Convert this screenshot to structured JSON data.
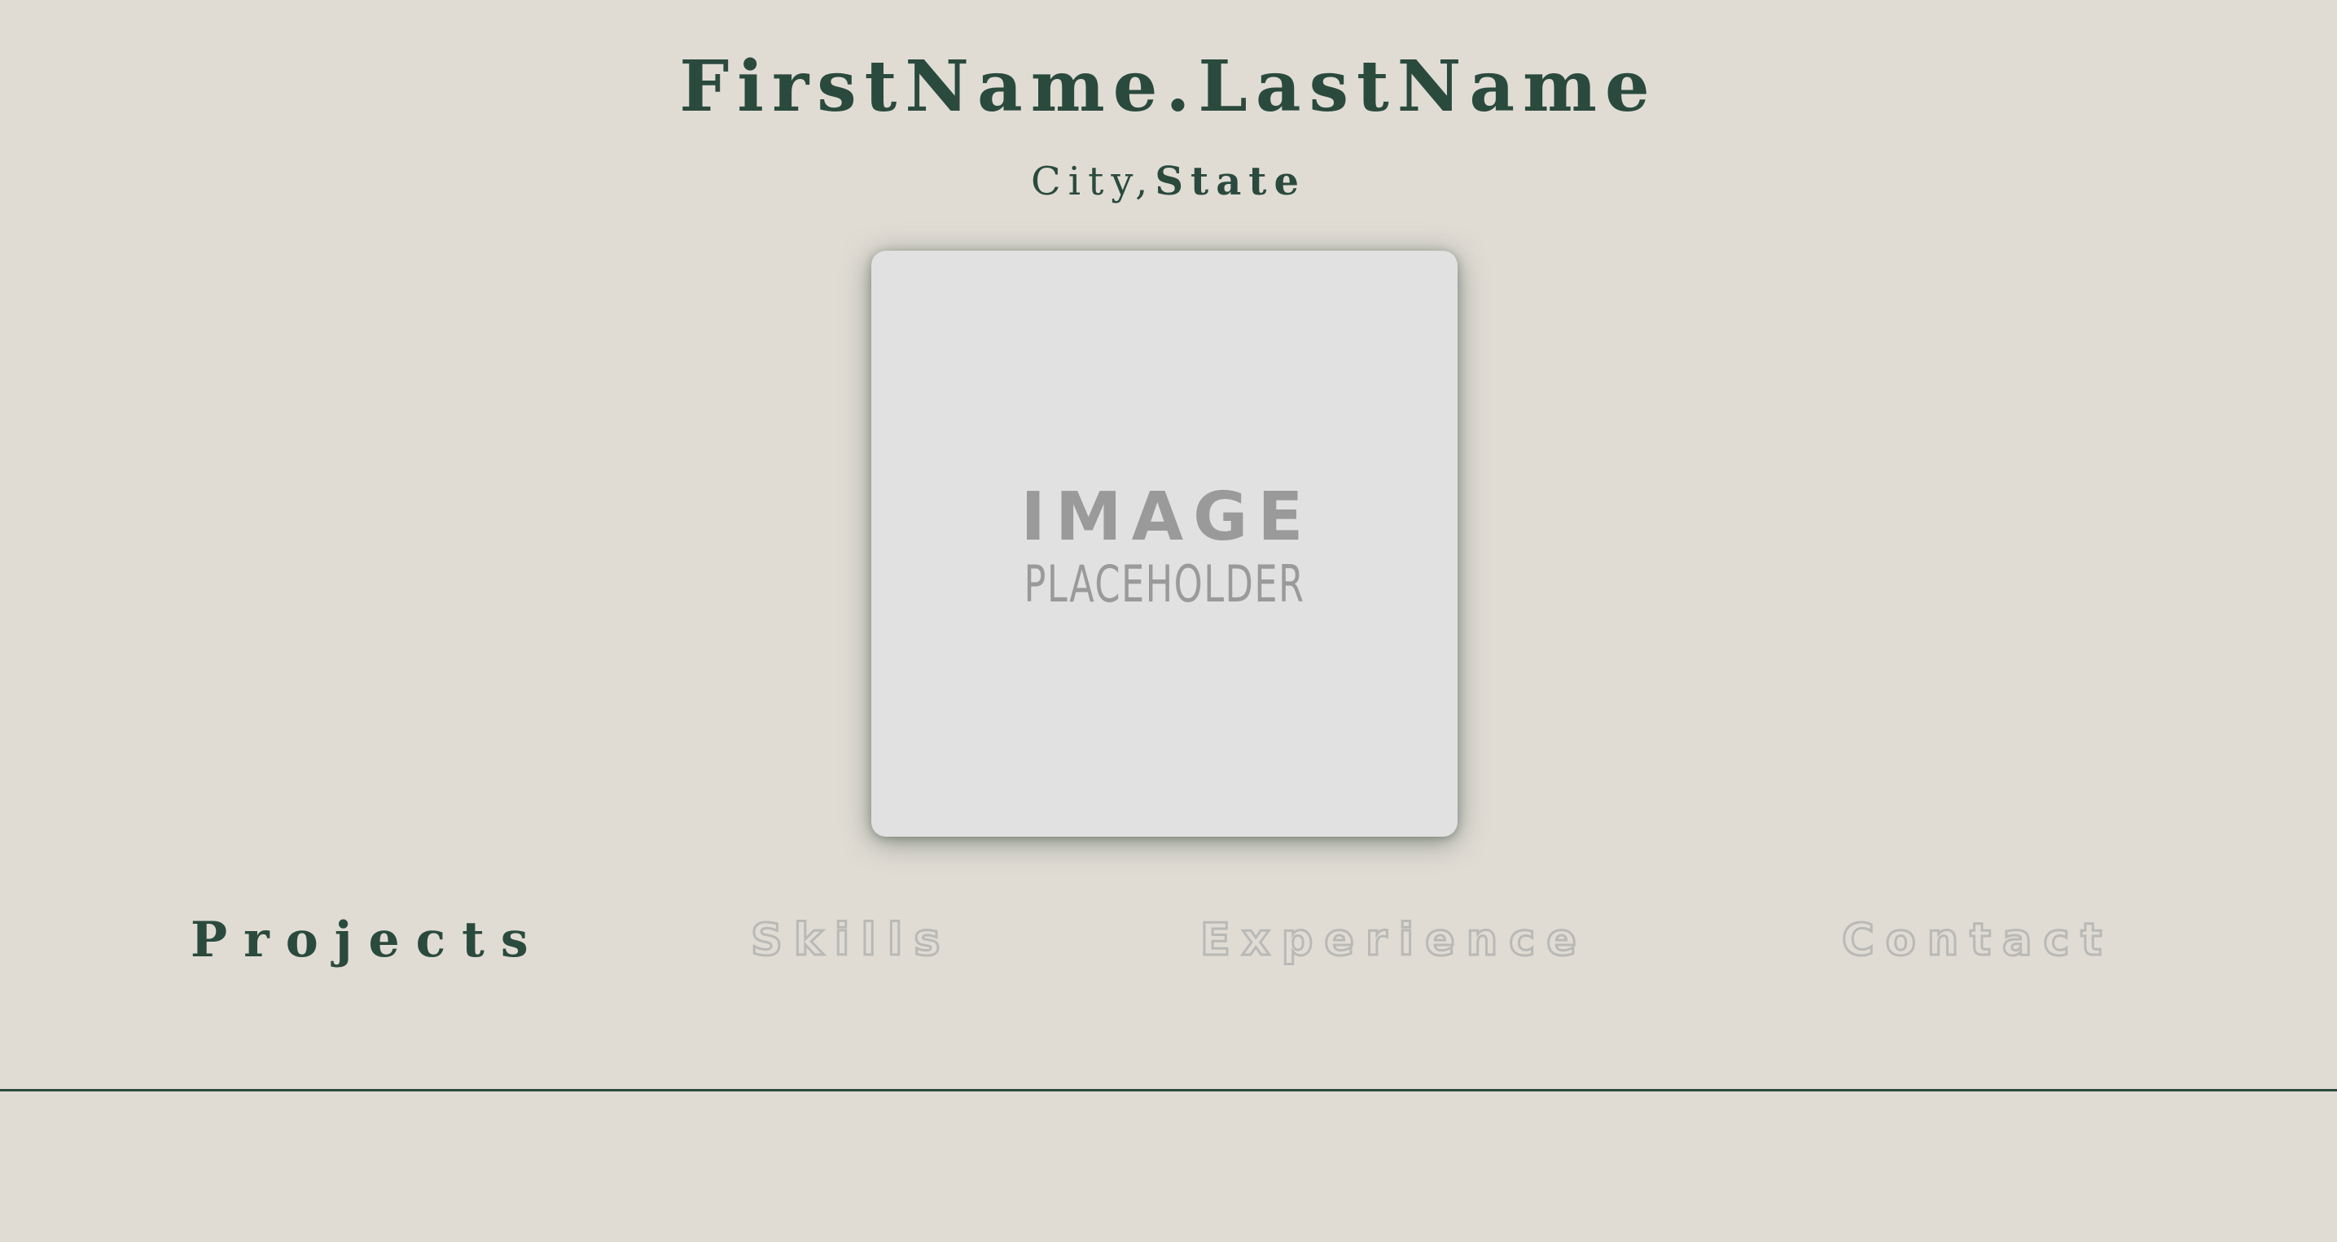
{
  "header": {
    "name": "FirstName.LastName",
    "city": "City,",
    "state": "State"
  },
  "photo": {
    "placeholder_line1": "IMAGE",
    "placeholder_line2": "PLACEHOLDER"
  },
  "nav": {
    "items": [
      {
        "label": "Projects",
        "active": true
      },
      {
        "label": "Skills",
        "active": false
      },
      {
        "label": "Experience",
        "active": false
      },
      {
        "label": "Contact",
        "active": false
      }
    ]
  },
  "colors": {
    "background": "#e0dcd4",
    "accent": "#2b4a3e",
    "inactive_outline": "#b9b9b6",
    "placeholder_fill": "#e1e1e1",
    "placeholder_text": "#9a9a9a"
  }
}
